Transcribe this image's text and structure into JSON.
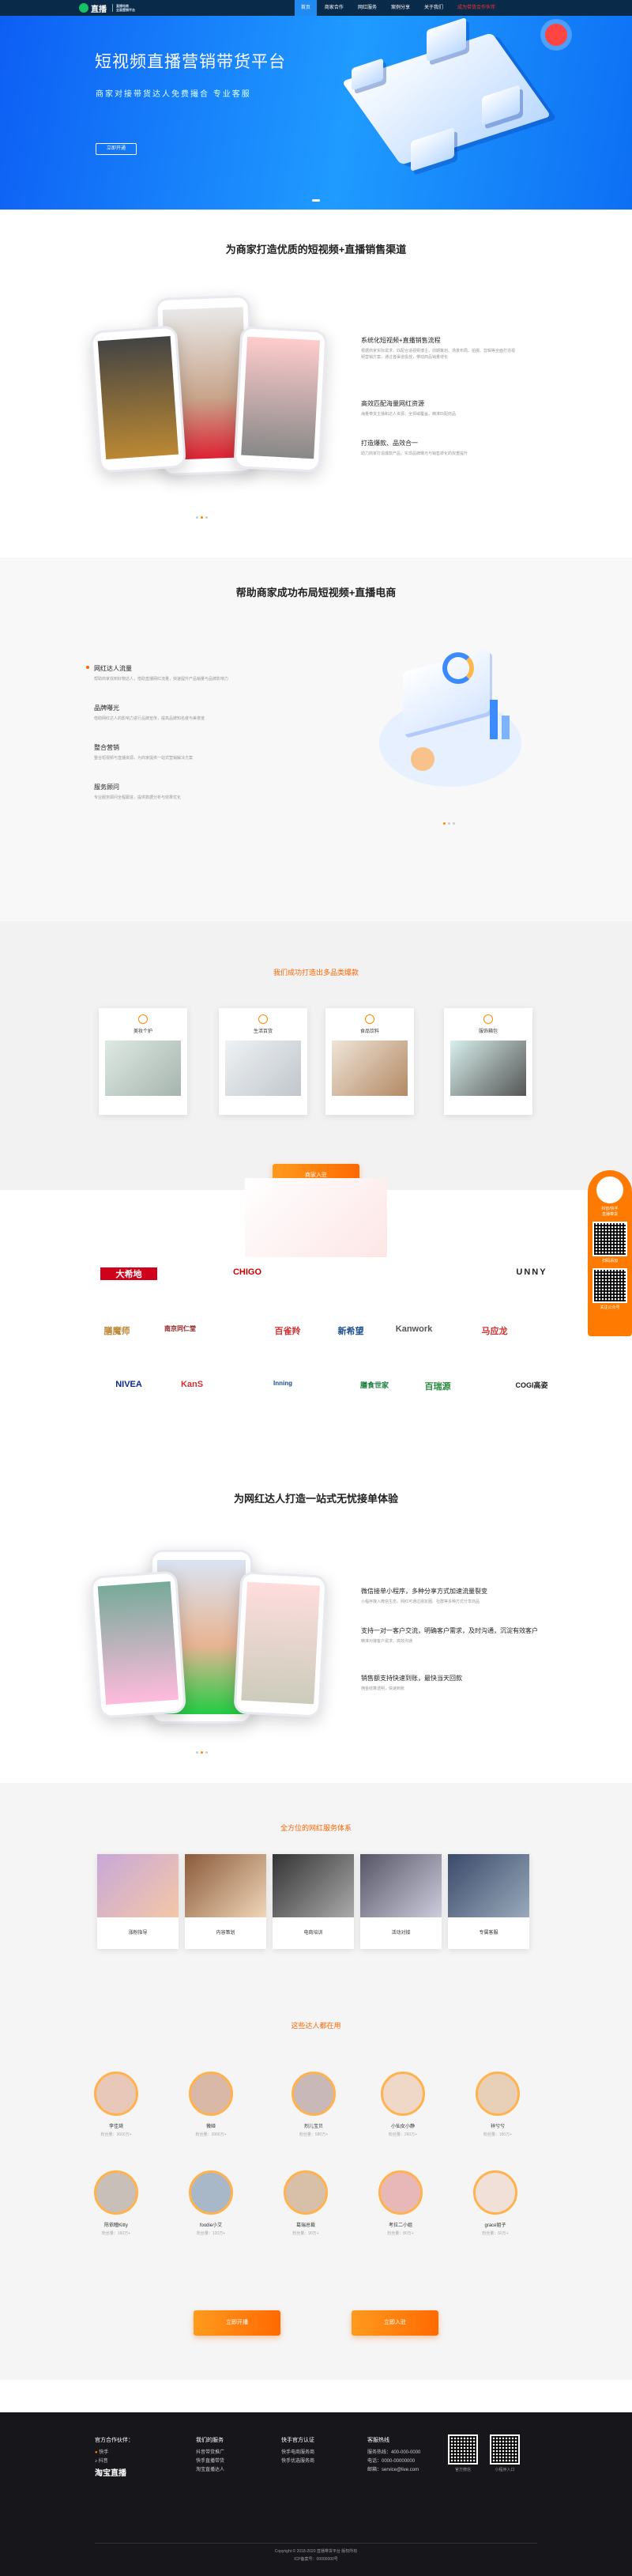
{
  "nav": {
    "logo": "直播",
    "logo_sub_1": "直播电商",
    "logo_sub_2": "全面营销平台",
    "items": [
      "首页",
      "商家合作",
      "网红服务",
      "案例分享",
      "关于我们",
      "成为带货合作伙伴"
    ]
  },
  "hero": {
    "title": "短视频直播营销带货平台",
    "subtitle": "商家对接带货达人免费撮合 专业客服",
    "button": "立即开通"
  },
  "sec1": {
    "title": "为商家打造优质的短视频+直播销售渠道",
    "features": [
      {
        "title": "系统化短视频+直播销售流程",
        "desc": "根据商家实际需求，匹配合适视频博主，前期策划、场景布局、拍摄、剪辑等全面打造视频营销方案，通过各渠道投放，带动商品销量增长"
      },
      {
        "title": "高效匹配海量网红资源",
        "desc": "海量带货主播和达人资源，全领域覆盖，精准匹配商品"
      },
      {
        "title": "打造爆款、品效合一",
        "desc": "助力商家打造爆款产品，实现品牌曝光与销售转化的双重提升"
      }
    ]
  },
  "sec2": {
    "title": "帮助商家成功布局短视频+直播电商",
    "features": [
      {
        "title": "网红达人流量",
        "desc": "帮助商家找到好物达人，借助直播网红流量，快速提升产品销量与品牌影响力"
      },
      {
        "title": "品牌曝光",
        "desc": "借助网红达人的影响力进行品牌宣传，提高品牌知名度与美誉度"
      },
      {
        "title": "整合营销",
        "desc": "整合短视频与直播资源，为商家提供一站式营销解决方案"
      },
      {
        "title": "服务顾问",
        "desc": "专业服务顾问全程跟进，提供数据分析与效果优化"
      }
    ]
  },
  "sec3": {
    "heading": "我们成功打造出多品类爆款",
    "categories": [
      "美妆个护",
      "生活百货",
      "食品饮料",
      "服饰箱包"
    ],
    "button": "商家入驻"
  },
  "brands": {
    "row1": [
      "大希地",
      "CHIGO",
      "",
      "",
      "",
      "UNNY"
    ],
    "row2": [
      "膳魔师",
      "南京同仁堂",
      "百雀羚",
      "新希望",
      "Kanwork",
      "马应龙"
    ],
    "row3": [
      "NIVEA",
      "KanS",
      "Inning",
      "膳食世家",
      "百瑞源",
      "COGI高姿"
    ]
  },
  "sec4": {
    "title": "为网红达人打造一站式无忧接单体验",
    "features": [
      {
        "title": "微信接单小程序，多种分享方式加速流量裂变",
        "desc": "小程序接入微信生态，网红可通过朋友圈、社群等多种方式分享商品"
      },
      {
        "title": "支持一对一客户交流，明确客户需求，及时沟通，沉淀有效客户",
        "desc": "精准对接客户需求，高效沟通"
      },
      {
        "title": "销售额支持快速到账，最快当天回款",
        "desc": "佣金结算透明，快速到账"
      }
    ]
  },
  "sec5": {
    "heading": "全方位的网红服务体系",
    "services": [
      "涨粉指导",
      "内容策划",
      "电商培训",
      "活动对接",
      "专属客服"
    ]
  },
  "sec6": {
    "heading": "这些达人都在用",
    "people": [
      {
        "name": "李佳琦",
        "fans": "粉丝量：3600万+"
      },
      {
        "name": "薇娅",
        "fans": "粉丝量：2900万+"
      },
      {
        "name": "烈儿宝贝",
        "fans": "粉丝量：580万+"
      },
      {
        "name": "小仙女小静",
        "fans": "粉丝量：260万+"
      },
      {
        "name": "祥兮兮",
        "fans": "粉丝量：180万+"
      },
      {
        "name": "陈依瞳Kitty",
        "fans": "粉丝量：160万+"
      },
      {
        "name": "foodie小艾",
        "fans": "粉丝量：120万+"
      },
      {
        "name": "葛瑞总裁",
        "fans": "粉丝量：90万+"
      },
      {
        "name": "考拉二小姐",
        "fans": "粉丝量：80万+"
      },
      {
        "name": "grace姐子",
        "fans": "粉丝量：60万+"
      }
    ],
    "btn1": "立即开播",
    "btn2": "立即入驻"
  },
  "float": {
    "line1": "抖音/快手",
    "line2": "直播带货",
    "caption1": "扫码添加",
    "caption2": "关注公众号"
  },
  "footer": {
    "col1": {
      "head": "官方合作伙伴：",
      "items": [
        "快手",
        "抖音"
      ],
      "brand": "淘宝直播"
    },
    "col2": {
      "head": "我们的服务",
      "items": [
        "抖音带货推广",
        "快手直播带货",
        "淘宝直播达人"
      ]
    },
    "col3": {
      "head": "快手官方认证",
      "items": [
        "快手电商服务商",
        "快手优选服务商"
      ]
    },
    "col4": {
      "head": "客服热线",
      "items": [
        "服务热线：400-000-0000",
        "电话：0000-00000000",
        "邮箱：service@live.com"
      ]
    },
    "qr1": "官方微信",
    "qr2": "小程序入口",
    "copyright": "Copyright © 2018-2020 直播带货平台 版权所有",
    "icp": "ICP备案号：00000000号"
  }
}
